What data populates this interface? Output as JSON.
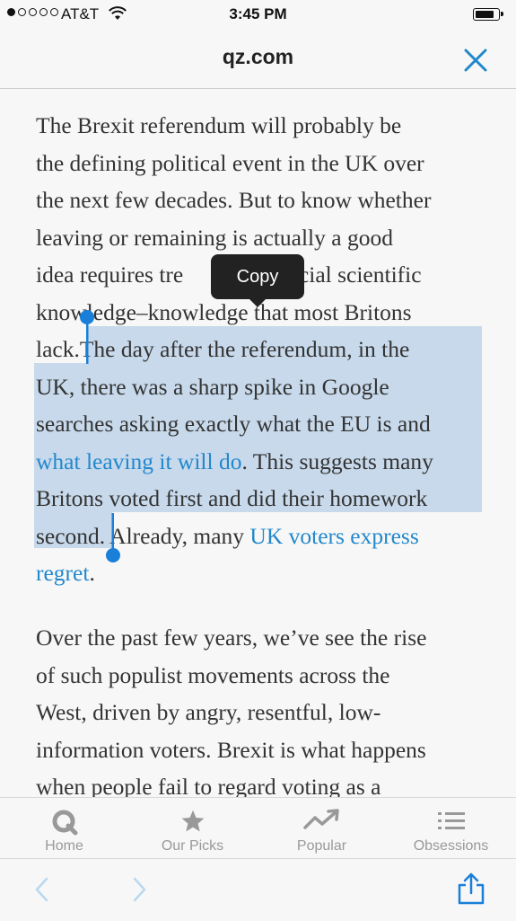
{
  "status_bar": {
    "carrier": "AT&T",
    "time": "3:45 PM",
    "signal_bars": 1
  },
  "header": {
    "domain": "qz.com"
  },
  "article": {
    "p1": {
      "l1": "The Brexit referendum will probably be",
      "l2": "the defining political event in the UK over",
      "l3": "the next few decades. But to know whether",
      "l4": "leaving or remaining is actually a good",
      "l5a": "idea requires tre",
      "l5b": "social scientific",
      "l6": "knowledge–knowledge that most Britons",
      "l7a": "lack.",
      "l7b": "The day after the referendum, in the",
      "l8": "UK, there was a sharp spike in Google",
      "l9": "searches asking exactly what the EU is and",
      "l10link": "what leaving it will do",
      "l10b": ". This suggests many",
      "l11": "Britons voted first and did their homework",
      "l12a": "second.",
      "l12b": " Already, many ",
      "l12link": "UK voters express",
      "l13link": "regret",
      "l13b": "."
    },
    "p2": {
      "l1": "Over the past few years, we’ve see the rise",
      "l2": "of such populist movements across the",
      "l3": "West, driven by angry, resentful, low-",
      "l4": "information voters. Brexit is what happens",
      "l5": "when people fail to regard voting as a"
    }
  },
  "context_menu": {
    "copy_label": "Copy"
  },
  "tabs": [
    {
      "label": "Home",
      "icon": "q-icon"
    },
    {
      "label": "Our Picks",
      "icon": "star-icon"
    },
    {
      "label": "Popular",
      "icon": "trending-icon"
    },
    {
      "label": "Obsessions",
      "icon": "list-icon"
    }
  ],
  "colors": {
    "accent": "#2288cc",
    "selection": "#c6d9ec",
    "handle": "#1a7fd9",
    "tab_inactive": "#999999"
  }
}
